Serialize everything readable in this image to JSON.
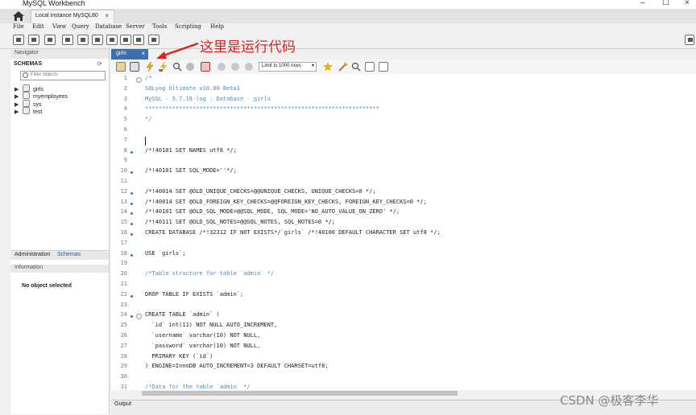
{
  "window": {
    "title": "MySQL Workbench"
  },
  "connection_tab": {
    "label": "Local instance MySQL80",
    "close": "×"
  },
  "menu": [
    "File",
    "Edit",
    "View",
    "Query",
    "Database",
    "Server",
    "Tools",
    "Scripting",
    "Help"
  ],
  "navigator": {
    "title": "Navigator",
    "schemas_label": "SCHEMAS",
    "filter_placeholder": "Filter objects",
    "schemas": [
      "girls",
      "myemployees",
      "sys",
      "test"
    ],
    "tabs": [
      "Administration",
      "Schemas"
    ],
    "info_title": "Information",
    "no_object": "No object selected"
  },
  "editor": {
    "tab_label": "girls",
    "tab_close": "×",
    "limit_label": "Limit to 1000 rows",
    "lines": [
      {
        "n": "1",
        "dot": false,
        "fold": true,
        "text": "/*",
        "cls": "cmt"
      },
      {
        "n": "2",
        "dot": false,
        "fold": false,
        "text": "SQLyog Ultimate v10.00 Beta1",
        "cls": "cmt"
      },
      {
        "n": "3",
        "dot": false,
        "fold": false,
        "text": "MySQL - 5.7.18-log : Database - girls",
        "cls": "cmt"
      },
      {
        "n": "4",
        "dot": false,
        "fold": false,
        "text": "*********************************************************************",
        "cls": "cmt"
      },
      {
        "n": "5",
        "dot": false,
        "fold": false,
        "text": "*/",
        "cls": "cmt"
      },
      {
        "n": "6",
        "dot": false,
        "fold": false,
        "text": "",
        "cls": ""
      },
      {
        "n": "7",
        "dot": false,
        "fold": false,
        "text": "",
        "cls": "",
        "cursor": true
      },
      {
        "n": "8",
        "dot": true,
        "fold": false,
        "text": "/*!40101 SET NAMES utf8 */;",
        "cls": ""
      },
      {
        "n": "9",
        "dot": false,
        "fold": false,
        "text": "",
        "cls": ""
      },
      {
        "n": "10",
        "dot": true,
        "fold": false,
        "text": "/*!40101 SET SQL_MODE=''*/;",
        "cls": ""
      },
      {
        "n": "11",
        "dot": false,
        "fold": false,
        "text": "",
        "cls": ""
      },
      {
        "n": "12",
        "dot": true,
        "fold": false,
        "text": "/*!40014 SET @OLD_UNIQUE_CHECKS=@@UNIQUE_CHECKS, UNIQUE_CHECKS=0 */;",
        "cls": ""
      },
      {
        "n": "13",
        "dot": true,
        "fold": false,
        "text": "/*!40014 SET @OLD_FOREIGN_KEY_CHECKS=@@FOREIGN_KEY_CHECKS, FOREIGN_KEY_CHECKS=0 */;",
        "cls": ""
      },
      {
        "n": "14",
        "dot": true,
        "fold": false,
        "text": "/*!40101 SET @OLD_SQL_MODE=@@SQL_MODE, SQL_MODE='NO_AUTO_VALUE_ON_ZERO' */;",
        "cls": ""
      },
      {
        "n": "15",
        "dot": true,
        "fold": false,
        "text": "/*!40111 SET @OLD_SQL_NOTES=@@SQL_NOTES, SQL_NOTES=0 */;",
        "cls": ""
      },
      {
        "n": "16",
        "dot": true,
        "fold": false,
        "text": "CREATE DATABASE /*!32312 IF NOT EXISTS*/`girls` /*!40100 DEFAULT CHARACTER SET utf8 */;",
        "cls": ""
      },
      {
        "n": "17",
        "dot": false,
        "fold": false,
        "text": "",
        "cls": ""
      },
      {
        "n": "18",
        "dot": true,
        "fold": false,
        "text": "USE `girls`;",
        "cls": ""
      },
      {
        "n": "19",
        "dot": false,
        "fold": false,
        "text": "",
        "cls": ""
      },
      {
        "n": "20",
        "dot": false,
        "fold": false,
        "text": "/*Table structure for table `admin` */",
        "cls": "cmt"
      },
      {
        "n": "21",
        "dot": false,
        "fold": false,
        "text": "",
        "cls": ""
      },
      {
        "n": "22",
        "dot": true,
        "fold": false,
        "text": "DROP TABLE IF EXISTS `admin`;",
        "cls": ""
      },
      {
        "n": "23",
        "dot": false,
        "fold": false,
        "text": "",
        "cls": ""
      },
      {
        "n": "24",
        "dot": true,
        "fold": true,
        "text": "CREATE TABLE `admin` (",
        "cls": ""
      },
      {
        "n": "25",
        "dot": false,
        "fold": false,
        "text": "  `id` int(11) NOT NULL AUTO_INCREMENT,",
        "cls": ""
      },
      {
        "n": "26",
        "dot": false,
        "fold": false,
        "text": "  `username` varchar(10) NOT NULL,",
        "cls": ""
      },
      {
        "n": "27",
        "dot": false,
        "fold": false,
        "text": "  `password` varchar(10) NOT NULL,",
        "cls": ""
      },
      {
        "n": "28",
        "dot": false,
        "fold": false,
        "text": "  PRIMARY KEY (`id`)",
        "cls": ""
      },
      {
        "n": "29",
        "dot": false,
        "fold": false,
        "text": ") ENGINE=InnoDB AUTO_INCREMENT=3 DEFAULT CHARSET=utf8;",
        "cls": ""
      },
      {
        "n": "30",
        "dot": false,
        "fold": false,
        "text": "",
        "cls": ""
      },
      {
        "n": "31",
        "dot": false,
        "fold": false,
        "text": "/*Data for the table `admin` */",
        "cls": "cmt"
      }
    ]
  },
  "output_label": "Output",
  "annotation": "这里是运行代码",
  "watermark": "CSDN @极客李华"
}
